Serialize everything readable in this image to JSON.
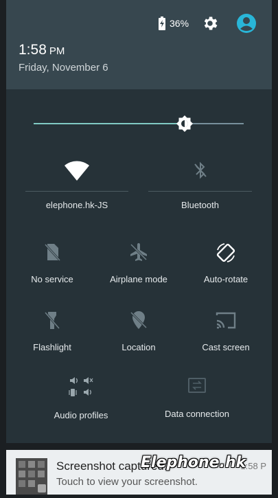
{
  "status": {
    "battery_percent": "36%",
    "battery_level": 0.36
  },
  "header": {
    "time": "1:58",
    "ampm": "PM",
    "date": "Friday, November 6"
  },
  "brightness": {
    "level": 0.72
  },
  "tiles": {
    "wifi": "elephone.hk-JS",
    "bluetooth": "Bluetooth",
    "no_service": "No service",
    "airplane": "Airplane mode",
    "autorotate": "Auto-rotate",
    "flashlight": "Flashlight",
    "location": "Location",
    "cast": "Cast screen",
    "audio": "Audio profiles",
    "data": "Data connection"
  },
  "notification": {
    "title": "Screenshot captured.",
    "text": "Touch to view your screenshot.",
    "time": "1:58 P"
  },
  "watermark": "Elephone.hk",
  "colors": {
    "accent": "#80cbc4",
    "avatar": "#29b6d8",
    "panel": "#263238",
    "header": "#37474f"
  }
}
